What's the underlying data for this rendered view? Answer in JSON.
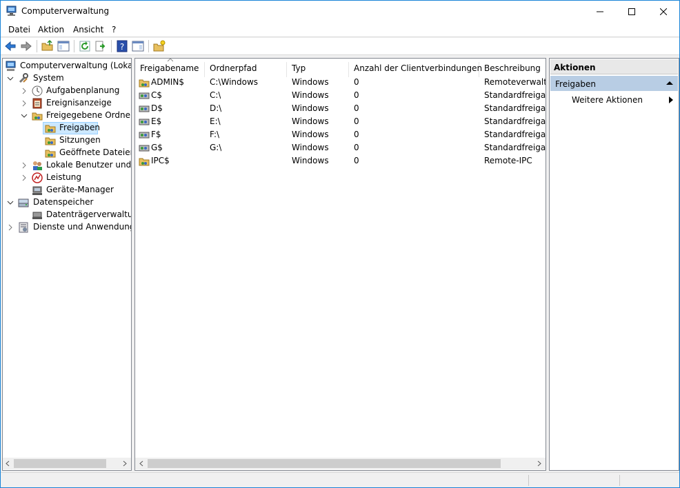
{
  "window": {
    "title": "Computerverwaltung"
  },
  "menu": [
    "Datei",
    "Aktion",
    "Ansicht",
    "?"
  ],
  "toolbar": {
    "icons": [
      "back-arrow-icon",
      "forward-arrow-icon",
      "up-folder-icon",
      "show-hide-tree-icon",
      "refresh-icon",
      "export-list-icon",
      "help-icon",
      "show-hide-action-pane-icon",
      "new-share-icon"
    ]
  },
  "tree": {
    "root": "Computerverwaltung (Lokal)",
    "system": "System",
    "aufgabenplanung": "Aufgabenplanung",
    "ereignisanzeige": "Ereignisanzeige",
    "freigegebene_ordner": "Freigegebene Ordner",
    "freigaben": "Freigaben",
    "sitzungen": "Sitzungen",
    "geoeffnete_dateien": "Geöffnete Dateien",
    "lokale_benutzer": "Lokale Benutzer und Gru",
    "leistung": "Leistung",
    "geraete_manager": "Geräte-Manager",
    "datenspeicher": "Datenspeicher",
    "datentraeger": "Datenträgerverwaltung",
    "dienste": "Dienste und Anwendungen"
  },
  "list": {
    "columns": [
      "Freigabename",
      "Ordnerpfad",
      "Typ",
      "Anzahl der Clientverbindungen",
      "Beschreibung"
    ],
    "rows": [
      {
        "name": "ADMIN$",
        "path": "C:\\Windows",
        "type": "Windows",
        "count": "0",
        "desc": "Remoteverwaltung"
      },
      {
        "name": "C$",
        "path": "C:\\",
        "type": "Windows",
        "count": "0",
        "desc": "Standardfreigabe"
      },
      {
        "name": "D$",
        "path": "D:\\",
        "type": "Windows",
        "count": "0",
        "desc": "Standardfreigabe"
      },
      {
        "name": "E$",
        "path": "E:\\",
        "type": "Windows",
        "count": "0",
        "desc": "Standardfreigabe"
      },
      {
        "name": "F$",
        "path": "F:\\",
        "type": "Windows",
        "count": "0",
        "desc": "Standardfreigabe"
      },
      {
        "name": "G$",
        "path": "G:\\",
        "type": "Windows",
        "count": "0",
        "desc": "Standardfreigabe"
      },
      {
        "name": "IPC$",
        "path": "",
        "type": "Windows",
        "count": "0",
        "desc": "Remote-IPC"
      }
    ]
  },
  "actions": {
    "header": "Aktionen",
    "section": "Freigaben",
    "more": "Weitere Aktionen"
  },
  "colors": {
    "selection": "#cce8ff",
    "action_section": "#b8cde4",
    "accent": "#1883d7"
  }
}
